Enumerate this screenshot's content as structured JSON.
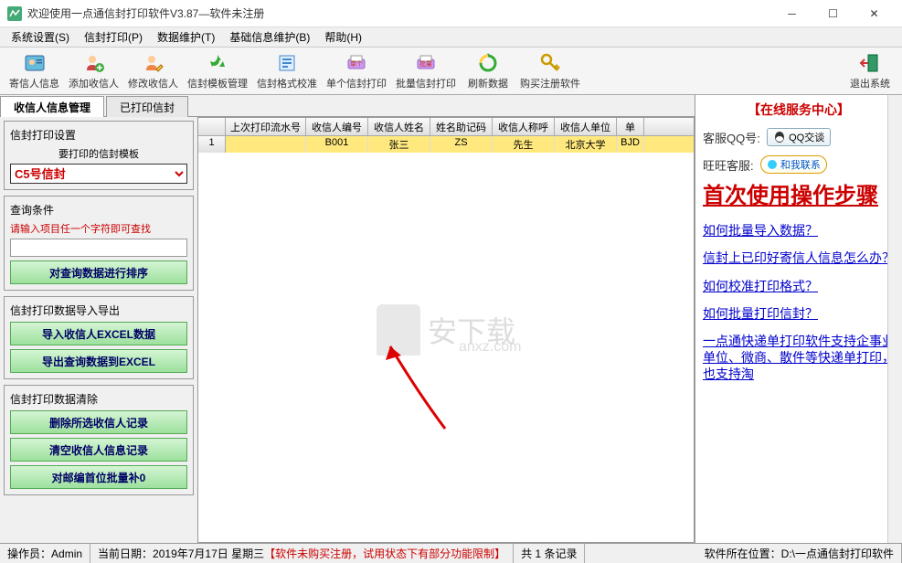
{
  "window": {
    "title": "欢迎使用一点通信封打印软件V3.87—软件未注册"
  },
  "menu": {
    "items": [
      "系统设置(S)",
      "信封打印(P)",
      "数据维护(T)",
      "基础信息维护(B)",
      "帮助(H)"
    ]
  },
  "toolbar": {
    "items": [
      {
        "label": "寄信人信息",
        "icon": "user-card"
      },
      {
        "label": "添加收信人",
        "icon": "user-add"
      },
      {
        "label": "修改收信人",
        "icon": "user-edit"
      },
      {
        "label": "信封模板管理",
        "icon": "recycle"
      },
      {
        "label": "信封格式校准",
        "icon": "align"
      },
      {
        "label": "单个信封打印",
        "icon": "print-one"
      },
      {
        "label": "批量信封打印",
        "icon": "print-batch"
      },
      {
        "label": "刷新数据",
        "icon": "refresh"
      },
      {
        "label": "购买注册软件",
        "icon": "key"
      },
      {
        "label": "退出系统",
        "icon": "exit"
      }
    ]
  },
  "tabs": {
    "t1": "收信人信息管理",
    "t2": "已打印信封"
  },
  "side": {
    "g1_title": "信封打印设置",
    "g1_sub": "要打印的信封模板",
    "template": "C5号信封",
    "g2_title": "查询条件",
    "g2_hint": "请输入项目任一个字符即可查找",
    "btn_sort": "对查询数据进行排序",
    "g3_title": "信封打印数据导入导出",
    "btn_import": "导入收信人EXCEL数据",
    "btn_export": "导出查询数据到EXCEL",
    "g4_title": "信封打印数据清除",
    "btn_del_sel": "删除所选收信人记录",
    "btn_clear": "清空收信人信息记录",
    "btn_pad": "对邮编首位批量补0"
  },
  "grid": {
    "headers": [
      "上次打印流水号",
      "收信人编号",
      "收信人姓名",
      "姓名助记码",
      "收信人称呼",
      "收信人单位",
      "单"
    ],
    "row1": {
      "num": "1",
      "c0": "",
      "c1": "B001",
      "c2": "张三",
      "c3": "ZS",
      "c4": "先生",
      "c5": "北京大学",
      "c6": "BJD"
    }
  },
  "right": {
    "title": "【在线服务中心】",
    "qq_label": "客服QQ号:",
    "qq_btn": "QQ交谈",
    "ww_label": "旺旺客服:",
    "ww_btn": "和我联系",
    "big": "首次使用操作步骤",
    "l1": "如何批量导入数据？",
    "l2": "信封上已印好寄信人信息怎么办？",
    "l3": "如何校准打印格式？",
    "l4": "如何批量打印信封？",
    "l5": "一点通快递单打印软件支持企事业单位、微商、散件等快递单打印，也支持淘"
  },
  "status": {
    "operator_label": "操作员：",
    "operator": "Admin",
    "date_label": "当前日期：",
    "date": "2019年7月17日 星期三",
    "warn": "【软件未购买注册，试用状态下有部分功能限制】",
    "count": "共 1 条记录",
    "loc_label": "软件所在位置：",
    "loc": "D:\\一点通信封打印软件"
  },
  "watermark": {
    "main": "安下载",
    "sub": "anxz.com"
  }
}
